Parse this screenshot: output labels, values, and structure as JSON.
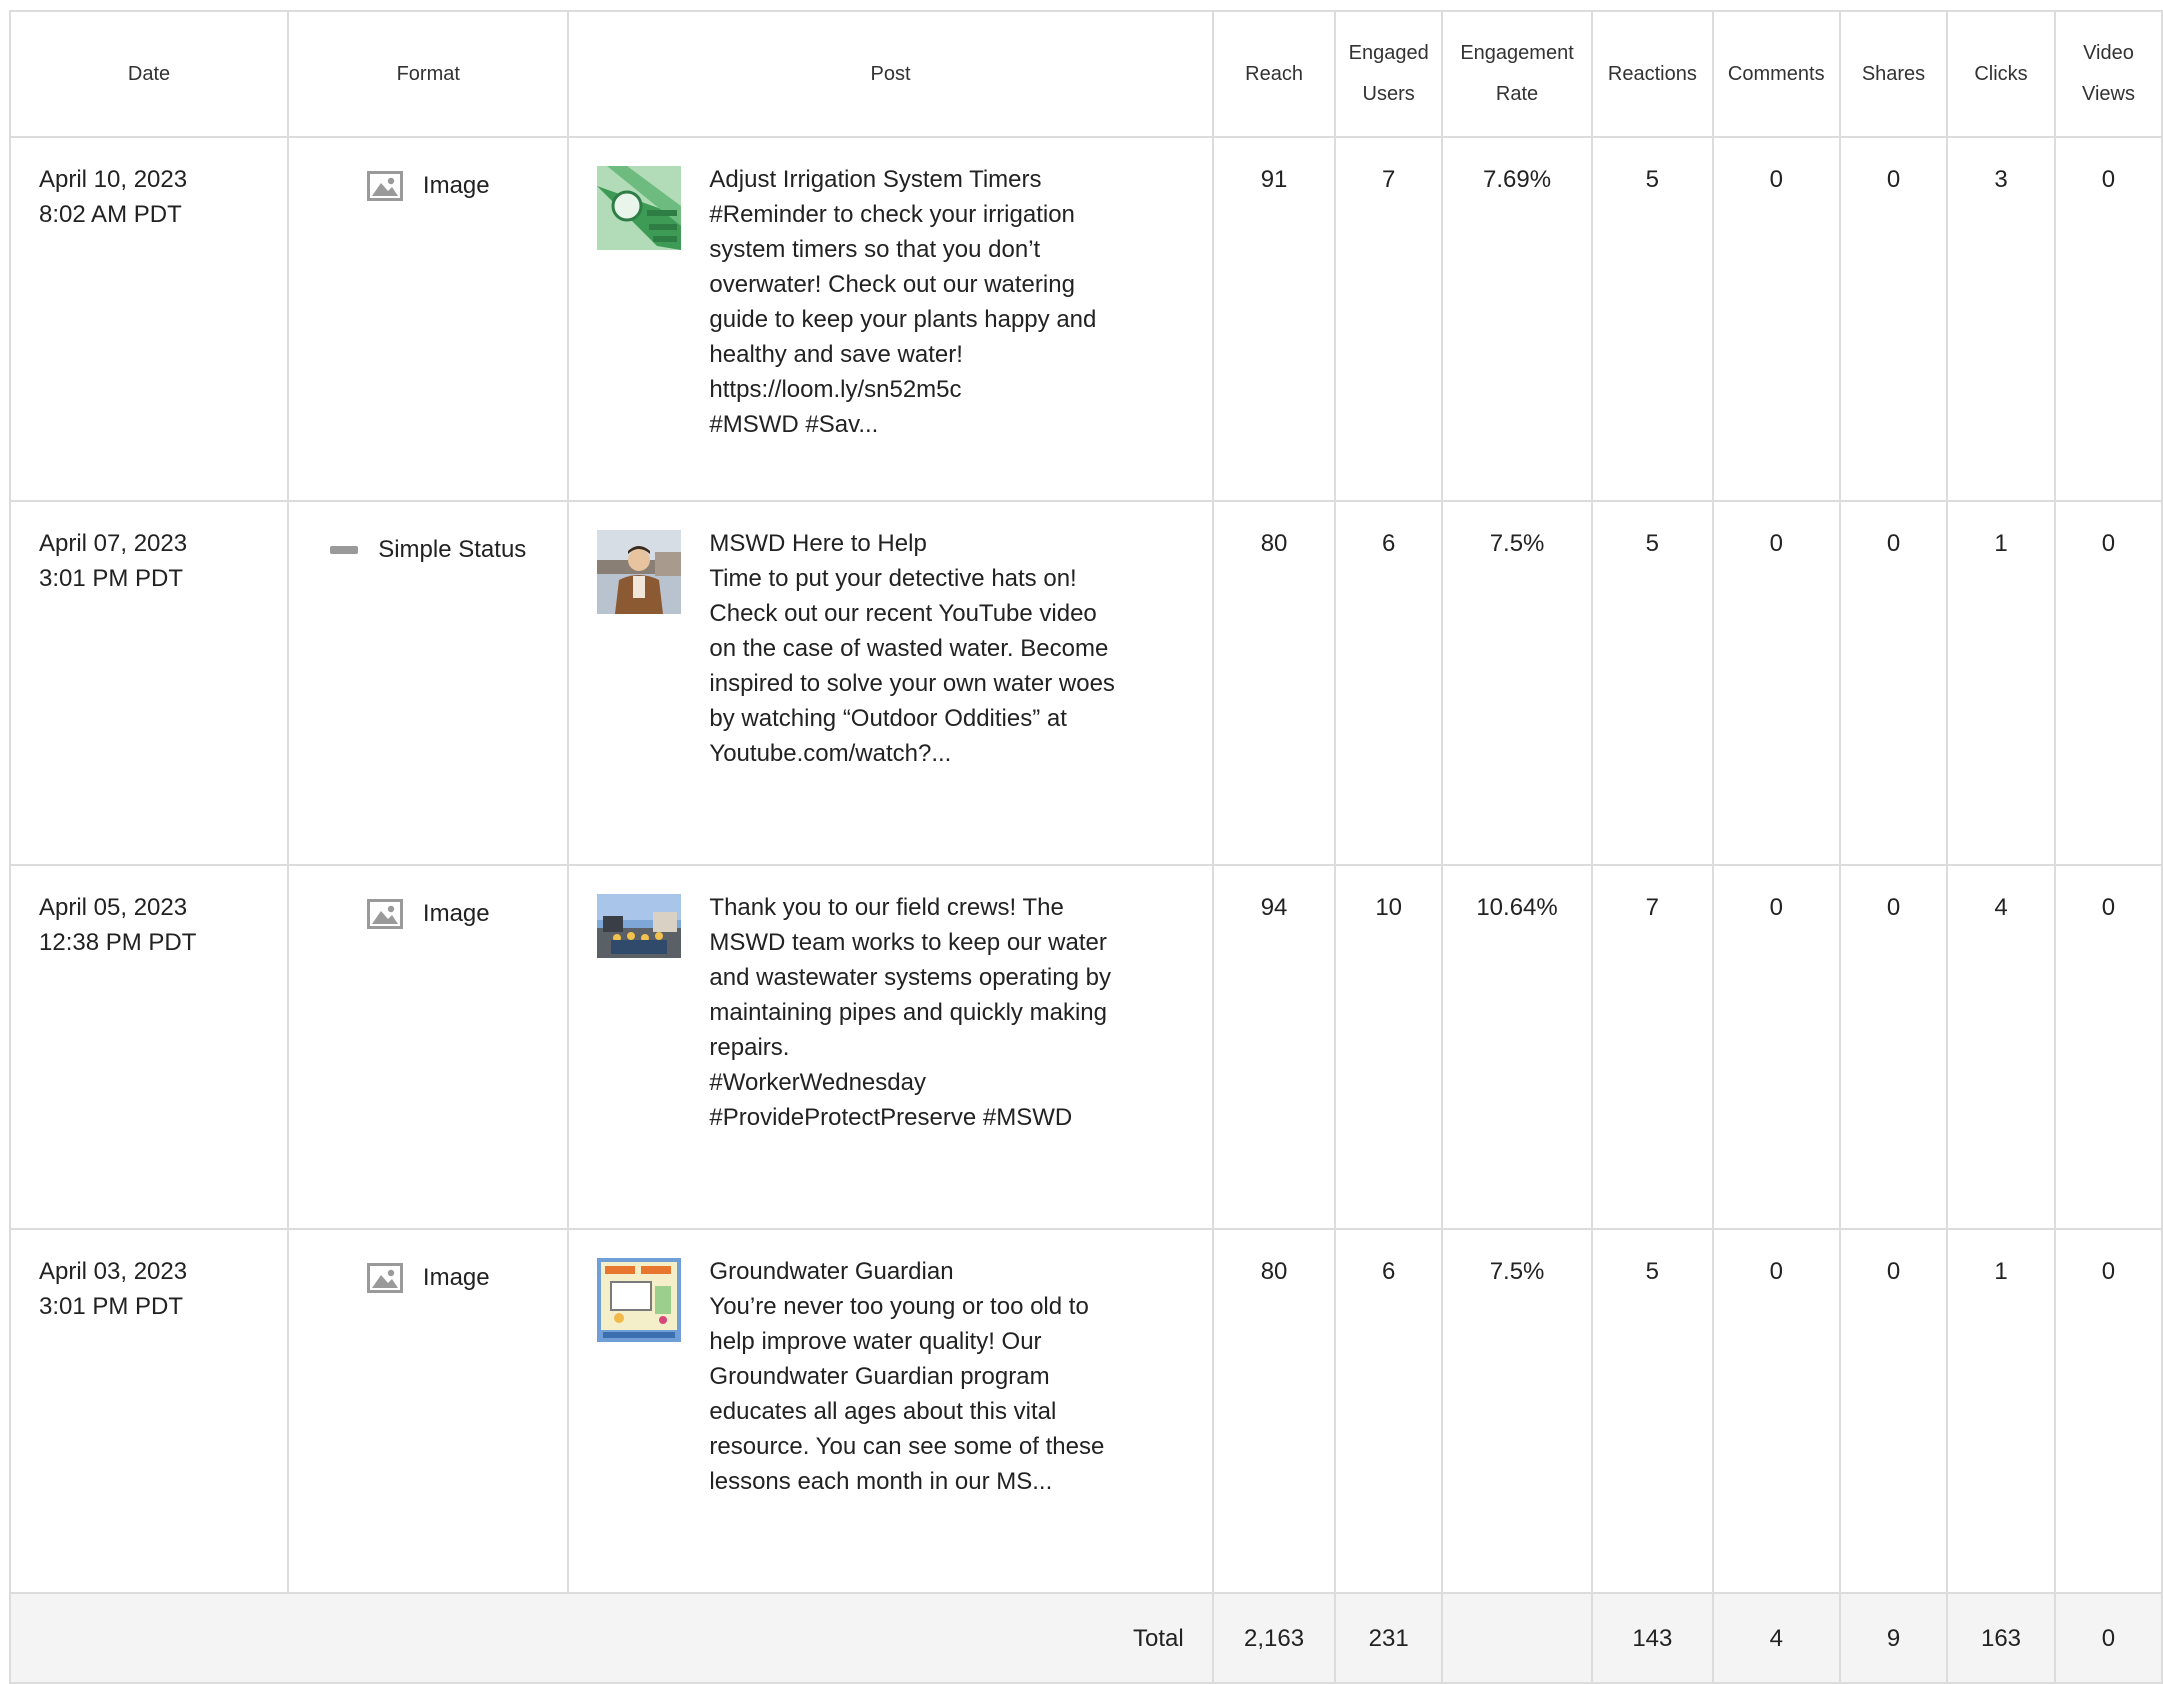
{
  "headers": {
    "date": "Date",
    "format": "Format",
    "post": "Post",
    "reach": "Reach",
    "engaged_users": [
      "Engaged",
      "Users"
    ],
    "engagement_rate": [
      "Engagement",
      "Rate"
    ],
    "reactions": "Reactions",
    "comments": "Comments",
    "shares": "Shares",
    "clicks": "Clicks",
    "video_views": [
      "Video",
      "Views"
    ]
  },
  "rows": [
    {
      "date": "April 10, 2023",
      "time": "8:02 AM PDT",
      "format": "Image",
      "format_icon": "image-icon",
      "post_lines": [
        "Adjust Irrigation System Timers",
        "#Reminder to check your irrigation",
        "system timers so that you don’t",
        "overwater! Check out our watering",
        "guide to keep your plants happy and",
        "healthy and save water!",
        "https://loom.ly/sn52m5c",
        "#MSWD #Sav..."
      ],
      "reach": "91",
      "engaged_users": "7",
      "engagement_rate": "7.69%",
      "reactions": "5",
      "comments": "0",
      "shares": "0",
      "clicks": "3",
      "video_views": "0"
    },
    {
      "date": "April 07, 2023",
      "time": "3:01 PM PDT",
      "format": "Simple Status",
      "format_icon": "status-bar-icon",
      "post_lines": [
        "MSWD Here to Help",
        "Time to put your detective hats on!",
        "Check out our recent YouTube video",
        "on the case of wasted water. Become",
        "inspired to solve your own water woes",
        "by watching “Outdoor Oddities” at",
        "Youtube.com/watch?..."
      ],
      "reach": "80",
      "engaged_users": "6",
      "engagement_rate": "7.5%",
      "reactions": "5",
      "comments": "0",
      "shares": "0",
      "clicks": "1",
      "video_views": "0"
    },
    {
      "date": "April 05, 2023",
      "time": "12:38 PM PDT",
      "format": "Image",
      "format_icon": "image-icon",
      "post_lines": [
        "Thank you to our field crews! The",
        "MSWD team works to keep our water",
        "and wastewater systems operating by",
        "maintaining pipes and quickly making",
        "repairs.",
        "#WorkerWednesday",
        "#ProvideProtectPreserve #MSWD"
      ],
      "reach": "94",
      "engaged_users": "10",
      "engagement_rate": "10.64%",
      "reactions": "7",
      "comments": "0",
      "shares": "0",
      "clicks": "4",
      "video_views": "0"
    },
    {
      "date": "April 03, 2023",
      "time": "3:01 PM PDT",
      "format": "Image",
      "format_icon": "image-icon",
      "post_lines": [
        "Groundwater Guardian",
        "You’re never too young or too old to",
        "help improve water quality! Our",
        "Groundwater Guardian program",
        "educates all ages about this vital",
        "resource. You can see some of these",
        "lessons each month in our MS..."
      ],
      "reach": "80",
      "engaged_users": "6",
      "engagement_rate": "7.5%",
      "reactions": "5",
      "comments": "0",
      "shares": "0",
      "clicks": "1",
      "video_views": "0"
    }
  ],
  "total": {
    "label": "Total",
    "reach": "2,163",
    "engaged_users": "231",
    "engagement_rate": "",
    "reactions": "143",
    "comments": "4",
    "shares": "9",
    "clicks": "163",
    "video_views": "0"
  },
  "colors": {
    "border": "#dcdcdc",
    "total_background": "#f4f4f4",
    "icon_gray": "#9a9a9a"
  }
}
